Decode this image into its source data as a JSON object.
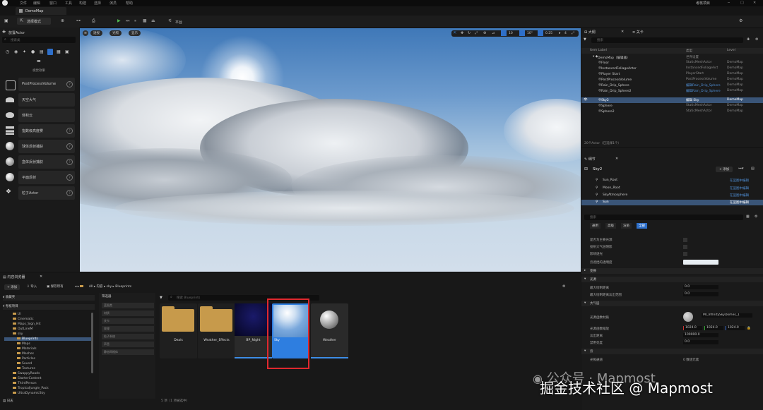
{
  "menu": {
    "items": [
      "文件",
      "编辑",
      "窗口",
      "工具",
      "构建",
      "选择",
      "演员",
      "帮助"
    ],
    "project": "考核项目"
  },
  "tabs": {
    "level_tab": "DemoMap"
  },
  "toolbar": {
    "mode": "选择模式",
    "platforms": "平台"
  },
  "left_panel": {
    "title": "放置Actor",
    "search_placeholder": "搜索类",
    "subtitle": "视觉效果",
    "items": [
      "PostProcessVolume",
      "天空大气",
      "体积云",
      "指数级高度雾",
      "球体反射捕获",
      "盒体反射捕获",
      "平面反射",
      "粒子Actor"
    ]
  },
  "viewport": {
    "mode_btn1": "透视",
    "mode_btn2": "光照",
    "mode_btn3": "显示",
    "snap1": "10",
    "snap2": "10°",
    "snap3": "0.25",
    "snap4": "4"
  },
  "outliner": {
    "tab1": "大纲",
    "tab2": "关卡",
    "search_placeholder": "搜索",
    "col_label": "Item Label",
    "col_type": "类型",
    "col_level": "Level",
    "rows": [
      {
        "label": "DemoMap（编辑器）",
        "type": "世界设置",
        "level": ""
      },
      {
        "label": "Floor",
        "type": "StaticMeshActor",
        "level": "DemoMap"
      },
      {
        "label": "InstancedFoliageActor",
        "type": "InstancedFoliageAct",
        "level": "DemoMap"
      },
      {
        "label": "Player Start",
        "type": "PlayerStart",
        "level": "DemoMap"
      },
      {
        "label": "PostProcessVolume",
        "type": "PostProcessVolume",
        "level": "DemoMap"
      },
      {
        "label": "Rain_Drip_Sphere",
        "type": "编辑Rain_Drip_Sphere",
        "level": "DemoMap"
      },
      {
        "label": "Rain_Drip_Sphere2",
        "type": "编辑Rain_Drip_Sphere",
        "level": "DemoMap"
      },
      {
        "label": "Sky2",
        "type": "编辑 Sky",
        "level": "DemoMap"
      },
      {
        "label": "Sphere",
        "type": "StaticMeshActor",
        "level": "DemoMap"
      },
      {
        "label": "Sphere2",
        "type": "StaticMeshActor",
        "level": "DemoMap"
      }
    ],
    "footer": "20个Actor（已选择1个）"
  },
  "details": {
    "tab": "细节",
    "actor_name": "Sky2",
    "add_btn": "+ 添加",
    "components": [
      {
        "name": "Sun_Root",
        "action": "在蓝图中编辑"
      },
      {
        "name": "Moon_Root",
        "action": "在蓝图中编辑"
      },
      {
        "name": "SkyAtmosphere",
        "action": "在蓝图中编辑"
      },
      {
        "name": "Sun",
        "action": "在蓝图中编辑"
      }
    ],
    "search_placeholder": "搜索",
    "filter_tabs": [
      "通用",
      "高级",
      "渲染",
      "全部"
    ],
    "properties": [
      {
        "name": "是否为主要光源",
        "value": ""
      },
      {
        "name": "投射大气层阴影",
        "value": ""
      },
      {
        "name": "影响透光",
        "value": ""
      },
      {
        "name": "云遮挡的透明度",
        "value": ""
      }
    ],
    "sections": [
      "变换",
      "光源",
      "大气层",
      "云"
    ],
    "light_props": [
      {
        "name": "最大绘制距离",
        "value": "0.0"
      },
      {
        "name": "最大绘制距离淡出范围",
        "value": "0.0"
      }
    ],
    "material_label": "光源函数材质",
    "material_value": "MI_InfinitySkyDomes_1",
    "scale_label": "光源函数缩放",
    "scale_values": [
      "1024.0",
      "1024.0",
      "1024.0"
    ],
    "fade_label": "淡出距离",
    "fade_value": "100000.0",
    "disabled_label": "禁用亮度",
    "disabled_value": "0.0",
    "extra_label": "光照通道",
    "extra_value": "0 数组元素"
  },
  "content_browser": {
    "tab": "内容浏览器",
    "add_btn": "+ 添加",
    "import_btn": "导入",
    "save_btn": "保存所有",
    "path": [
      "All",
      "内容",
      "sky",
      "Blueprints"
    ],
    "favorites": "收藏夹",
    "project": "考核项目",
    "tree": [
      "UI",
      "Cinematic",
      "Maps_Sign_Hit",
      "OutLineM",
      "sky",
      "Blueprints",
      "Maps",
      "Materials",
      "Meshes",
      "Particles",
      "Sound",
      "Textures",
      "SwappyRoads",
      "StarterContent",
      "ThirdPerson",
      "TropicalJungle_Pack",
      "UltraDynamicSky"
    ],
    "filter_title": "筛选器",
    "filters": [
      "蓝图类",
      "材质",
      "关卡",
      "纹理",
      "粒子系统",
      "声音",
      "静态网格体"
    ],
    "search_placeholder": "搜索 Blueprints",
    "assets": [
      {
        "name": "Deals",
        "kind": "folder"
      },
      {
        "name": "Weather_Effects",
        "kind": "folder"
      },
      {
        "name": "BP_Night",
        "kind": "night"
      },
      {
        "name": "Sky",
        "kind": "sky"
      },
      {
        "name": "Weather",
        "kind": "sphere"
      }
    ],
    "footer": "5 项（1 项被选中）",
    "bottom_tab": "日志"
  },
  "watermark": {
    "line1": "公众号 · Mapmost",
    "line2": "掘金技术社区 @ Mapmost"
  }
}
